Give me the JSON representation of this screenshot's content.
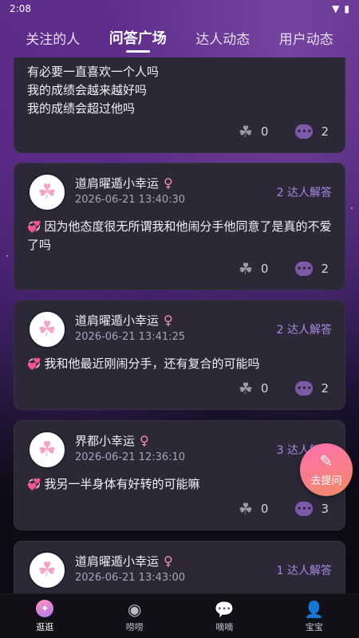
{
  "status": {
    "time": "2:08"
  },
  "tabs": [
    {
      "label": "关注的人"
    },
    {
      "label": "问答广场"
    },
    {
      "label": "达人动态"
    },
    {
      "label": "用户动态"
    }
  ],
  "first_card": {
    "lines": [
      "有必要一直喜欢一个人吗",
      "我的成绩会越来越好吗",
      "我的成绩会超过他吗"
    ],
    "likes": "0",
    "comments": "2"
  },
  "posts": [
    {
      "username": "道肩曜遁小幸运",
      "time": "2026-06-21 13:40:30",
      "experts": "2 达人解答",
      "question": "因为他态度很无所谓我和他闹分手他同意了是真的不爱了吗",
      "likes": "0",
      "comments": "2"
    },
    {
      "username": "道肩曜遁小幸运",
      "time": "2026-06-21 13:41:25",
      "experts": "2 达人解答",
      "question": "我和他最近刚闹分手，还有复合的可能吗",
      "likes": "0",
      "comments": "2"
    },
    {
      "username": "界都小幸运",
      "time": "2026-06-21 12:36:10",
      "experts": "3 达人解答",
      "question": "我另一半身体有好转的可能嘛",
      "likes": "0",
      "comments": "3"
    },
    {
      "username": "道肩曜遁小幸运",
      "time": "2026-06-21 13:43:00",
      "experts": "1 达人解答"
    }
  ],
  "fab": {
    "label": "去提问"
  },
  "bottom_nav": [
    {
      "label": "逛逛"
    },
    {
      "label": "唠唠"
    },
    {
      "label": "嘀嘀"
    },
    {
      "label": "宝宝"
    }
  ],
  "colors": {
    "accent": "#a98ae0",
    "card": "#2c2838",
    "fab": "#ff6fb0"
  }
}
